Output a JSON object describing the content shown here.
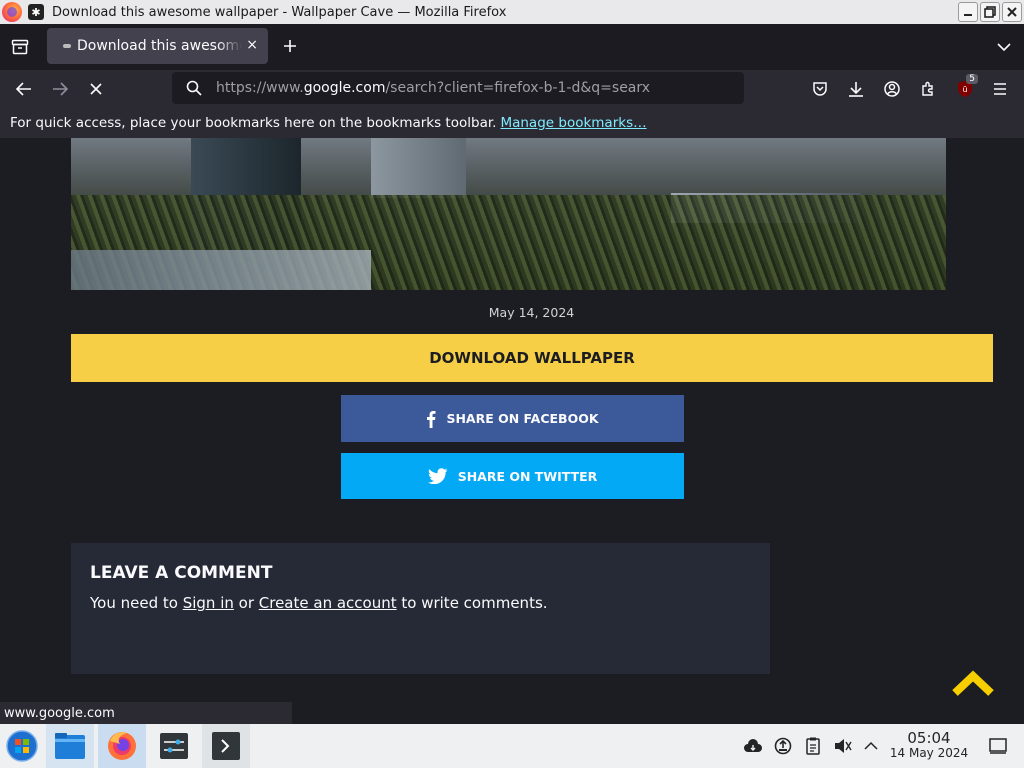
{
  "window": {
    "title": "Download this awesome wallpaper - Wallpaper Cave — Mozilla Firefox"
  },
  "tab": {
    "label": "Download this awesome wallpaper - Wallpaper Cave",
    "close": "×"
  },
  "urlbar": {
    "prefix": "https://www.",
    "domain": "google.com",
    "path": "/search?client=firefox-b-1-d&q=searx"
  },
  "toolbar": {
    "extension_badge": "5"
  },
  "bookmarks_bar": {
    "text": "For quick access, place your bookmarks here on the bookmarks toolbar.",
    "link": "Manage bookmarks…"
  },
  "page": {
    "date": "May 14, 2024",
    "download_label": "DOWNLOAD WALLPAPER",
    "facebook_label": "SHARE ON FACEBOOK",
    "twitter_label": "SHARE ON TWITTER",
    "comment": {
      "heading": "LEAVE A COMMENT",
      "pre": "You need to ",
      "signin": "Sign in",
      "mid": " or ",
      "create": "Create an account",
      "post": " to write comments."
    }
  },
  "status_link": "www.google.com",
  "taskbar": {
    "time": "05:04",
    "date": "14 May 2024"
  },
  "colors": {
    "download_button": "#f7cf47",
    "facebook_button": "#3c5a9a",
    "twitter_button": "#03a9f4",
    "page_background": "#1b1d23",
    "comment_box": "#252a36",
    "link_accent": "#80ebff"
  }
}
